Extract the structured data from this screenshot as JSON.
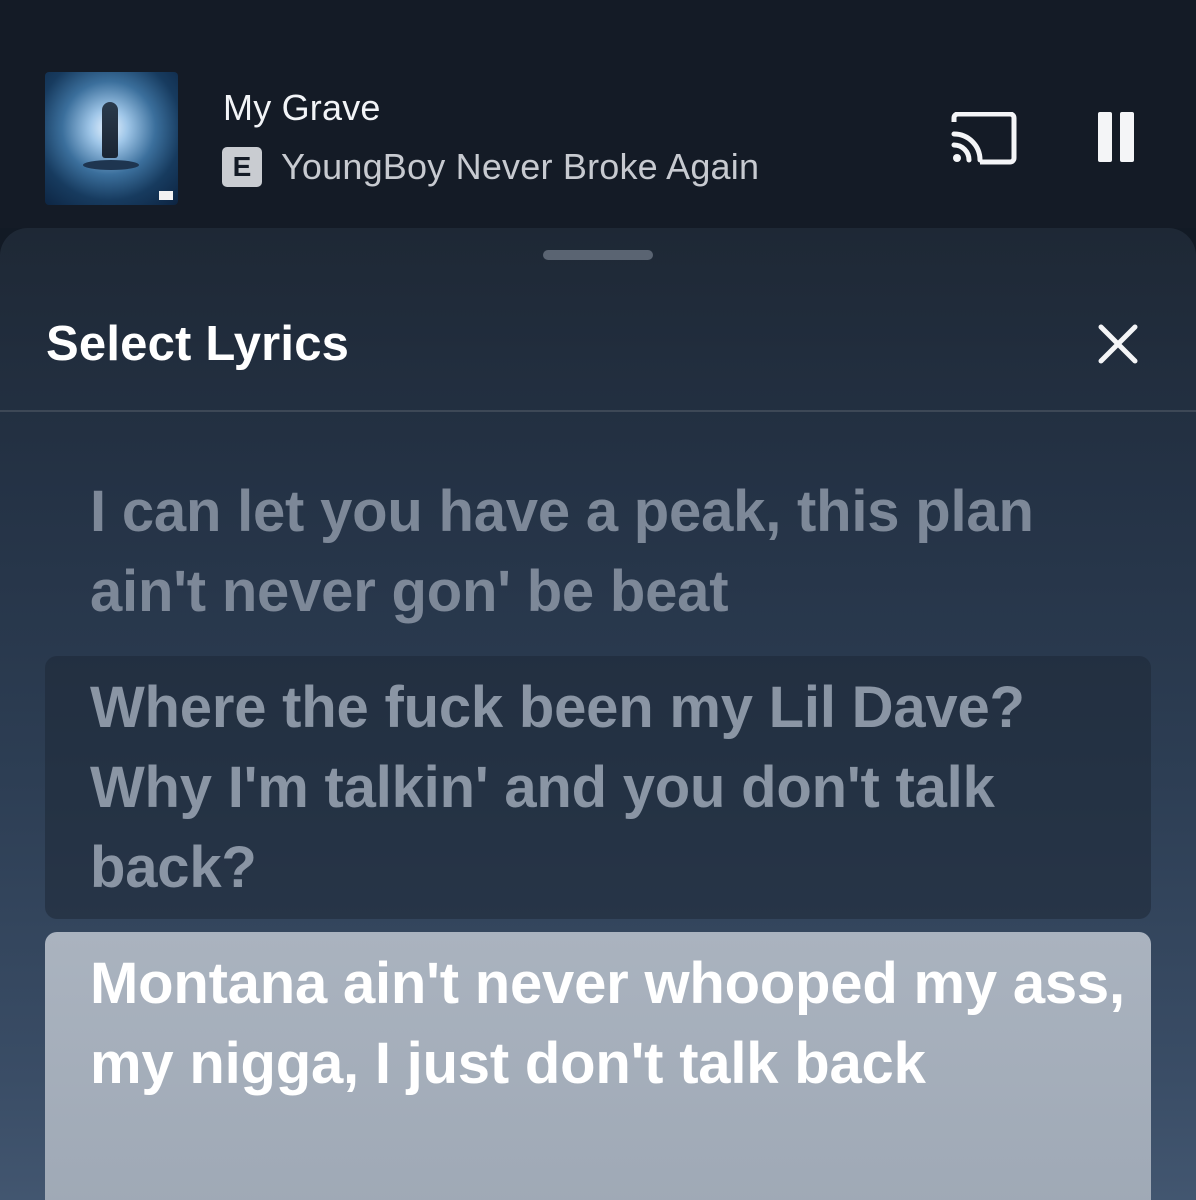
{
  "now_playing": {
    "track_title": "My Grave",
    "explicit_badge": "E",
    "artist": "YoungBoy Never Broke Again",
    "icons": {
      "album_art": "album-art",
      "cast": "cast-icon",
      "pause": "pause-icon"
    }
  },
  "sheet": {
    "title": "Select Lyrics",
    "close_icon": "close-icon",
    "lyrics": [
      {
        "text": "I can let you have a peak, this plan ain't never gon' be beat",
        "selected": false
      },
      {
        "text": "Where the fuck been my Lil Dave? Why I'm talkin' and you don't talk back?",
        "selected": false
      },
      {
        "text": "Montana ain't never whooped my ass, my nigga, I just don't talk back",
        "selected": true
      }
    ]
  },
  "colors": {
    "background": "#121a25",
    "selected_line_bg": "#aab3bf",
    "dim_text": "#7d8898",
    "accent_text": "#ffffff"
  }
}
